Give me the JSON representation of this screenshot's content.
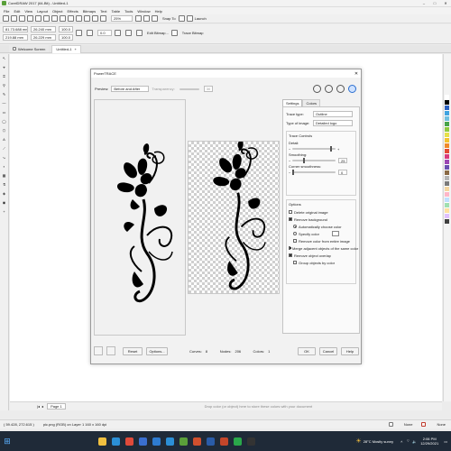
{
  "window": {
    "title": "CorelDRAW 2017 (64-Bit) - Untitled-1"
  },
  "menu": [
    "File",
    "Edit",
    "View",
    "Layout",
    "Object",
    "Effects",
    "Bitmaps",
    "Text",
    "Table",
    "Tools",
    "Window",
    "Help"
  ],
  "toolbar": {
    "zoom": "25%",
    "snap_to": "Snap To",
    "launch": "Launch"
  },
  "propbar": {
    "x": "81.73.688 mm",
    "y": "219.88 mm",
    "w": "26.240 mm",
    "h": "26.229 mm",
    "sx": "100.0",
    "sy": "100.0",
    "angle": "0.0",
    "edit_bitmap": "Edit Bitmap...",
    "trace_bitmap": "Trace Bitmap"
  },
  "doc_tabs": [
    "Welcome Screen",
    "Untitled-1"
  ],
  "dialog": {
    "title": "PowerTRACE",
    "preview_label": "Preview:",
    "preview_mode": "Before and After",
    "transparency_label": "Transparency:",
    "transparency_value": "30",
    "tabs": [
      "Settings",
      "Colors"
    ],
    "trace_type_label": "Trace type:",
    "trace_type": "Outline",
    "image_type_label": "Type of image:",
    "image_type": "Detailed logo",
    "trace_controls": "Trace Controls",
    "detail_label": "Detail:",
    "detail_level": 0.92,
    "smoothing_label": "Smoothing:",
    "smoothing_value": "25",
    "smoothing_level": 0.25,
    "corner_label": "Corner smoothness:",
    "corner_value": "0",
    "corner_level": 0.0,
    "options": "Options",
    "opt_delete_original": "Delete original image",
    "opt_remove_bg": "Remove background",
    "opt_auto_color": "Automatically choose color",
    "opt_specify_color": "Specify color",
    "opt_remove_entire": "Remove color from entire image",
    "opt_merge_adjacent": "Merge adjacent objects of the same color",
    "opt_remove_overlap": "Remove object overlap",
    "opt_group_by_color": "Group objects by color",
    "reset": "Reset",
    "options_btn": "Options...",
    "curves_label": "Curves:",
    "curves_value": "8",
    "nodes_label": "Nodes:",
    "nodes_value": "206",
    "colors_label": "Colors:",
    "colors_value": "1",
    "ok": "OK",
    "cancel": "Cancel",
    "help": "Help"
  },
  "page_tab": "Page 1",
  "status": {
    "coords": "( 59.428, 272.615 )",
    "object": "pic.png (RGB) on Layer 1 160 x 160 dpi",
    "hint": "Drop color (or object) here to store these colors with your document",
    "none1": "None",
    "none2": "None"
  },
  "taskbar": {
    "weather": "28°C  Mostly sunny",
    "time": "2:06 PM",
    "date": "12/29/2021",
    "apps": [
      {
        "name": "file-explorer",
        "color": "#f0c040"
      },
      {
        "name": "edge",
        "color": "#2b8fd6"
      },
      {
        "name": "chrome",
        "color": "#e04a3a"
      },
      {
        "name": "store",
        "color": "#3a6fd0"
      },
      {
        "name": "mail",
        "color": "#2e7bcf"
      },
      {
        "name": "vscode",
        "color": "#2c8fd6"
      },
      {
        "name": "coreldraw",
        "color": "#5aa03a"
      },
      {
        "name": "photos",
        "color": "#d0502e"
      },
      {
        "name": "word",
        "color": "#2a5ca8"
      },
      {
        "name": "powerpoint",
        "color": "#c4462a"
      },
      {
        "name": "spotify",
        "color": "#2aa84a"
      },
      {
        "name": "terminal",
        "color": "#333333"
      }
    ]
  },
  "palette": [
    "#ffffff",
    "#000000",
    "#2a5fbf",
    "#3fa3e0",
    "#6fbfe0",
    "#46a34a",
    "#8fca3f",
    "#e6e04a",
    "#f2c230",
    "#f08a2b",
    "#e34a33",
    "#d83a7c",
    "#9b47b3",
    "#6b4fb0",
    "#8a6a45",
    "#b5b5b5",
    "#7a7a7a",
    "#f5d6a0",
    "#ffb6c8",
    "#c0e0ff",
    "#a0e0b0",
    "#ffe0a0",
    "#e0c0ff",
    "#404040"
  ]
}
